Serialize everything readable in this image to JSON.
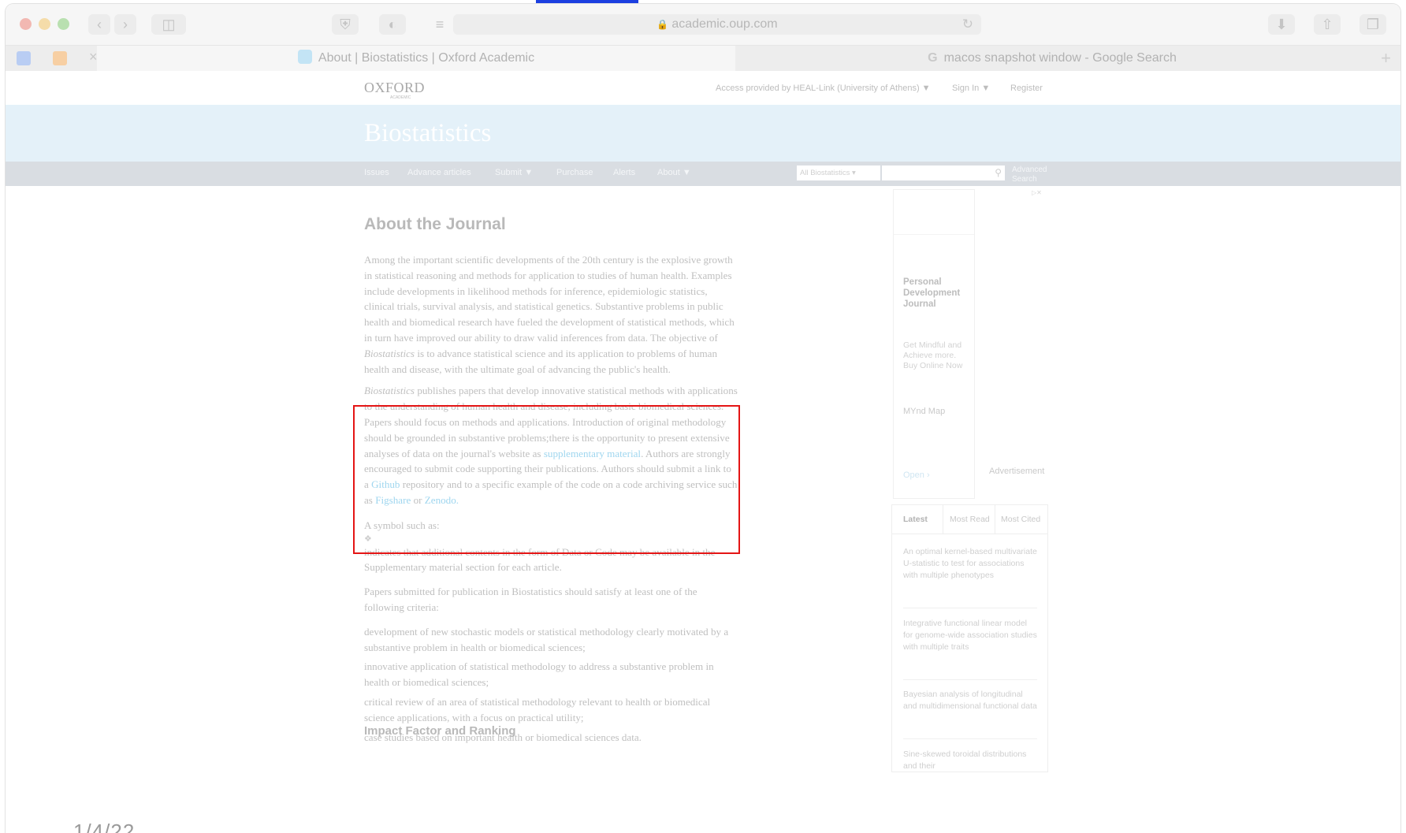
{
  "browser": {
    "url": "academic.oup.com",
    "tabs": [
      {
        "title": "About | Biostatistics | Oxford Academic",
        "active": true
      },
      {
        "title": "macos snapshot window - Google Search",
        "active": false
      }
    ]
  },
  "site": {
    "logo": "OXFORD",
    "logo_sub": "ACADEMIC",
    "access_text": "Access provided by HEAL-Link (University of Athens)",
    "signin": "Sign In",
    "register": "Register",
    "journal_title": "Biostatistics"
  },
  "nav": {
    "items": [
      "Issues",
      "Advance articles",
      "Submit",
      "Purchase",
      "Alerts",
      "About"
    ],
    "search_scope": "All Biostatistics",
    "advanced_search": "Advanced Search"
  },
  "main": {
    "heading": "About the Journal",
    "para1": "Among the important scientific developments of the 20th century is the explosive growth in statistical reasoning and methods for application to studies of human health. Examples include developments in likelihood methods for inference, epidemiologic statistics, clinical trials, survival analysis, and statistical genetics. Substantive problems in public health and biomedical research have fueled the development of statistical methods, which in turn have improved our ability to draw valid inferences from data. The objective of",
    "para1_italic": "Biostatistics",
    "para1_end": "is to advance statistical science and its application to problems of human health and disease, with the ultimate goal of advancing the public's health.",
    "para2_italic": "Biostatistics",
    "para2_a": "publishes papers that develop innovative statistical methods with applications to the understanding of human health and disease, including basic biomedical sciences. Papers should focus on methods and applications. Introduction of original methodology should be grounded in substantive problems;there is the opportunity to present extensive analyses of data on the journal's website as",
    "para2_link1": "supplementary material",
    "para2_b": ". Authors are strongly encouraged to submit code supporting their publications. Authors should submit a link to a",
    "para2_link2": "Github",
    "para2_c": "repository and to a specific example of the code on a code archiving service such as",
    "para2_link3": "Figshare",
    "para2_or": "or",
    "para2_link4": "Zenodo",
    "para2_end": ".",
    "symbol_intro": "A symbol such as:",
    "symbol_desc": "indicates that additional contents in the form of Data or Code may be available in the Supplementary material section for each article.",
    "criteria_intro": "Papers submitted for publication in Biostatistics should satisfy at least one of the following criteria:",
    "criteria": [
      "development of new stochastic models or statistical methodology clearly motivated by a substantive problem in health or biomedical sciences;",
      "innovative application of statistical methodology to address a substantive problem in health or biomedical sciences;",
      "critical review of an area of statistical methodology relevant to health or biomedical science applications, with a focus on practical utility;",
      "case studies based on important health or biomedical sciences data."
    ],
    "impact_heading": "Impact Factor and Ranking"
  },
  "date_stamp": "1/4/22",
  "ad": {
    "choices": "▷✕",
    "title": "Personal Development Journal",
    "text": "Get Mindful and Achieve more. Buy Online Now",
    "brand": "MYnd Map",
    "open": "Open ›",
    "label": "Advertisement"
  },
  "sidebar_tabs": {
    "tabs": [
      "Latest",
      "Most Read",
      "Most Cited"
    ],
    "articles": [
      "An optimal kernel-based multivariate U-statistic to test for associations with multiple phenotypes",
      "Integrative functional linear model for genome-wide association studies with multiple traits",
      "Bayesian analysis of longitudinal and multidimensional functional data",
      "Sine-skewed toroidal distributions and their"
    ]
  }
}
